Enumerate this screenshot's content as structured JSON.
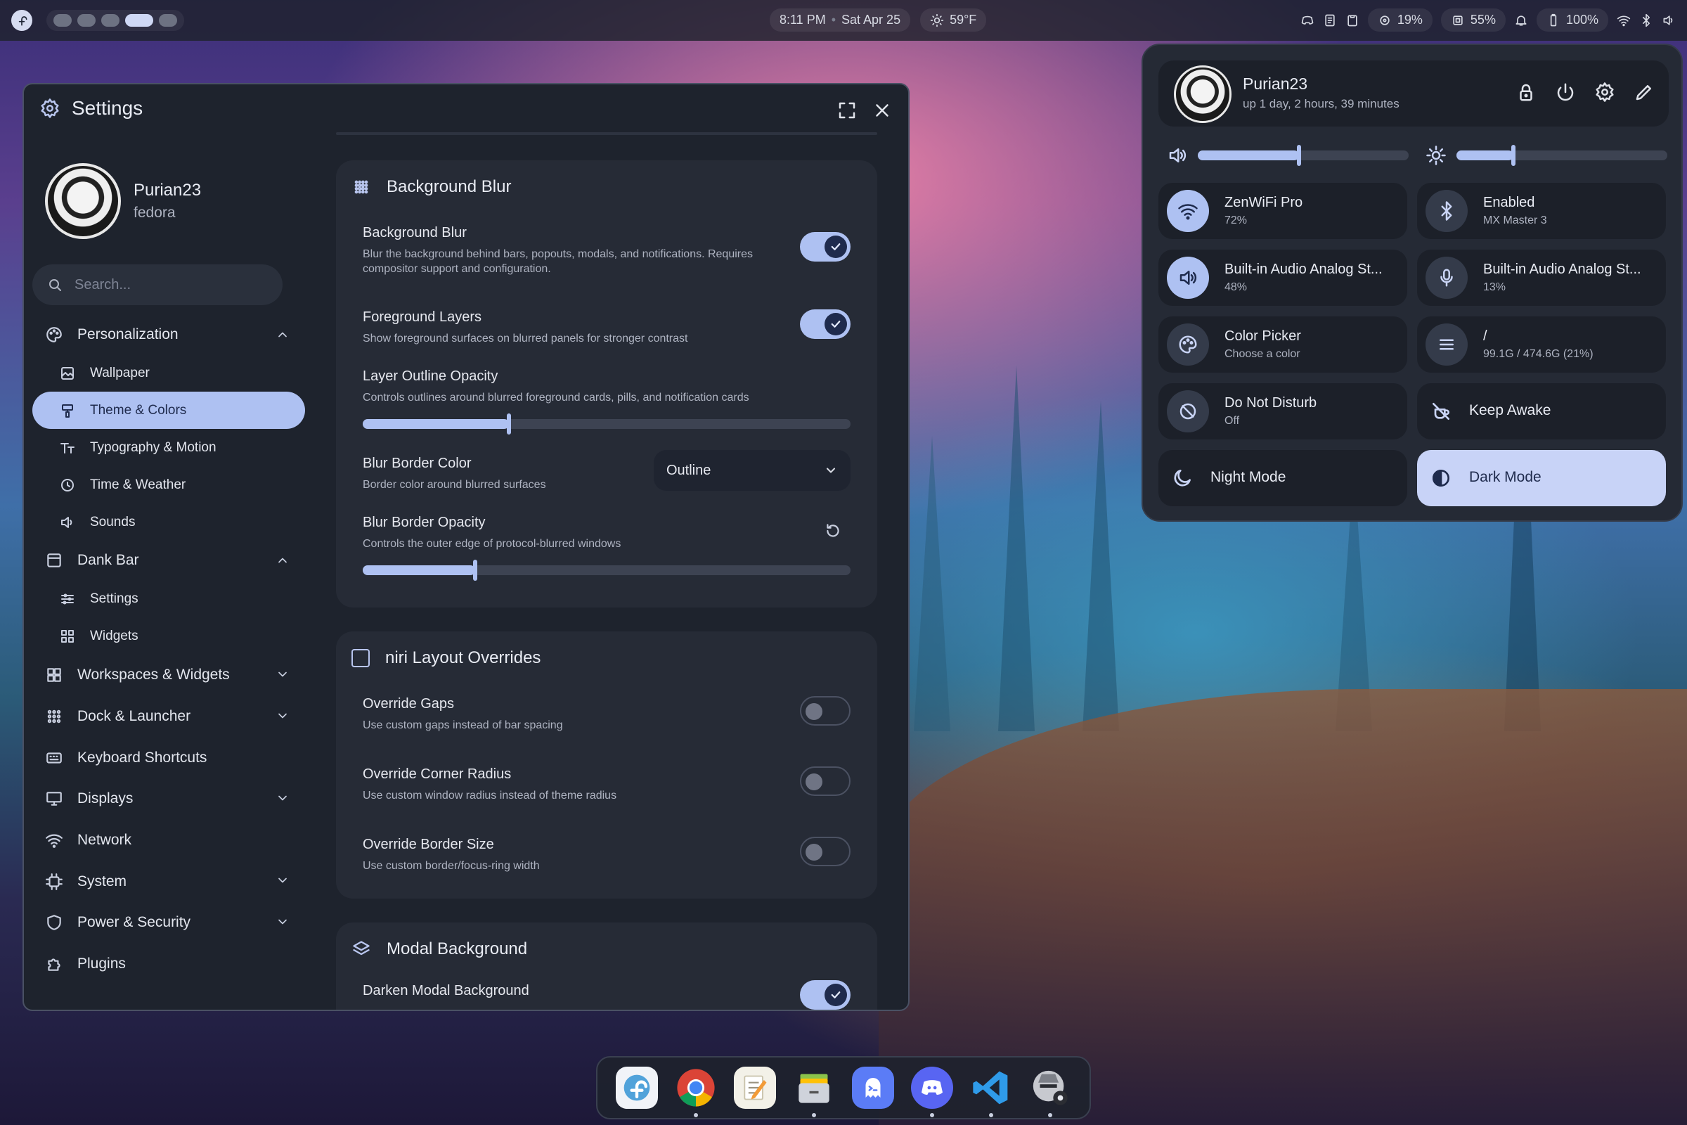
{
  "topbar": {
    "time": "8:11 PM",
    "date": "Sat Apr 25",
    "weather": "59°F",
    "cpu": "19%",
    "memory": "55%",
    "battery": "100%"
  },
  "settings": {
    "title": "Settings",
    "user": {
      "name": "Purian23",
      "host": "fedora"
    },
    "search_placeholder": "Search...",
    "nav": {
      "personalization": "Personalization",
      "wallpaper": "Wallpaper",
      "theme": "Theme & Colors",
      "typography": "Typography & Motion",
      "time_weather": "Time & Weather",
      "sounds": "Sounds",
      "dank_bar": "Dank Bar",
      "bar_settings": "Settings",
      "widgets": "Widgets",
      "workspaces": "Workspaces & Widgets",
      "dock": "Dock & Launcher",
      "keyboard": "Keyboard Shortcuts",
      "displays": "Displays",
      "network": "Network",
      "system": "System",
      "power": "Power & Security",
      "plugins": "Plugins"
    },
    "blur_card": {
      "title": "Background Blur",
      "bg_blur_title": "Background Blur",
      "bg_blur_desc": "Blur the background behind bars, popouts, modals, and notifications. Requires compositor support and configuration.",
      "bg_blur_on": true,
      "fg_title": "Foreground Layers",
      "fg_desc": "Show foreground surfaces on blurred panels for stronger contrast",
      "fg_on": true,
      "outline_title": "Layer Outline Opacity",
      "outline_desc": "Controls outlines around blurred foreground cards, pills, and notification cards",
      "outline_value": 0.3,
      "border_color_title": "Blur Border Color",
      "border_color_desc": "Border color around blurred surfaces",
      "border_color_value": "Outline",
      "border_opacity_title": "Blur Border Opacity",
      "border_opacity_desc": "Controls the outer edge of protocol-blurred windows",
      "border_opacity_value": 0.23
    },
    "niri_card": {
      "title": "niri Layout Overrides",
      "gaps_title": "Override Gaps",
      "gaps_desc": "Use custom gaps instead of bar spacing",
      "radius_title": "Override Corner Radius",
      "radius_desc": "Use custom window radius instead of theme radius",
      "border_title": "Override Border Size",
      "border_desc": "Use custom border/focus-ring width"
    },
    "modal_card": {
      "title": "Modal Background",
      "darken_title": "Darken Modal Background"
    }
  },
  "control_center": {
    "user": "Purian23",
    "uptime": "up 1 day, 2 hours, 39 minutes",
    "volume": 0.48,
    "brightness": 0.27,
    "tiles": {
      "wifi_title": "ZenWiFi Pro",
      "wifi_sub": "72%",
      "bt_title": "Enabled",
      "bt_sub": "MX Master 3",
      "audio_out_title": "Built-in Audio Analog St...",
      "audio_out_sub": "48%",
      "audio_in_title": "Built-in Audio Analog St...",
      "audio_in_sub": "13%",
      "picker_title": "Color Picker",
      "picker_sub": "Choose a color",
      "disk_title": "/",
      "disk_sub": "99.1G / 474.6G (21%)",
      "dnd_title": "Do Not Disturb",
      "dnd_sub": "Off",
      "awake_title": "Keep Awake",
      "night_title": "Night Mode",
      "dark_title": "Dark Mode"
    }
  },
  "colors": {
    "accent": "#aec1f2",
    "surface": "#1e232d",
    "card": "#262b36"
  }
}
